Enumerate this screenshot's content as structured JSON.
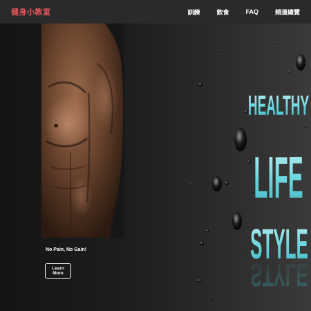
{
  "navbar": {
    "brand": "健身小教室",
    "links": [
      "訓練",
      "飲食",
      "FAQ",
      "頻道總覽"
    ]
  },
  "hero": {
    "headline_lines": [
      "HEALTHY",
      "LIFE",
      "STYLE"
    ],
    "tagline": "No Pain, No Gain!",
    "cta_label": "Learn More"
  },
  "colors": {
    "brand": "#e0565a",
    "navbar_bg": "#2a2a2a",
    "headline": "#5fd3dc"
  }
}
